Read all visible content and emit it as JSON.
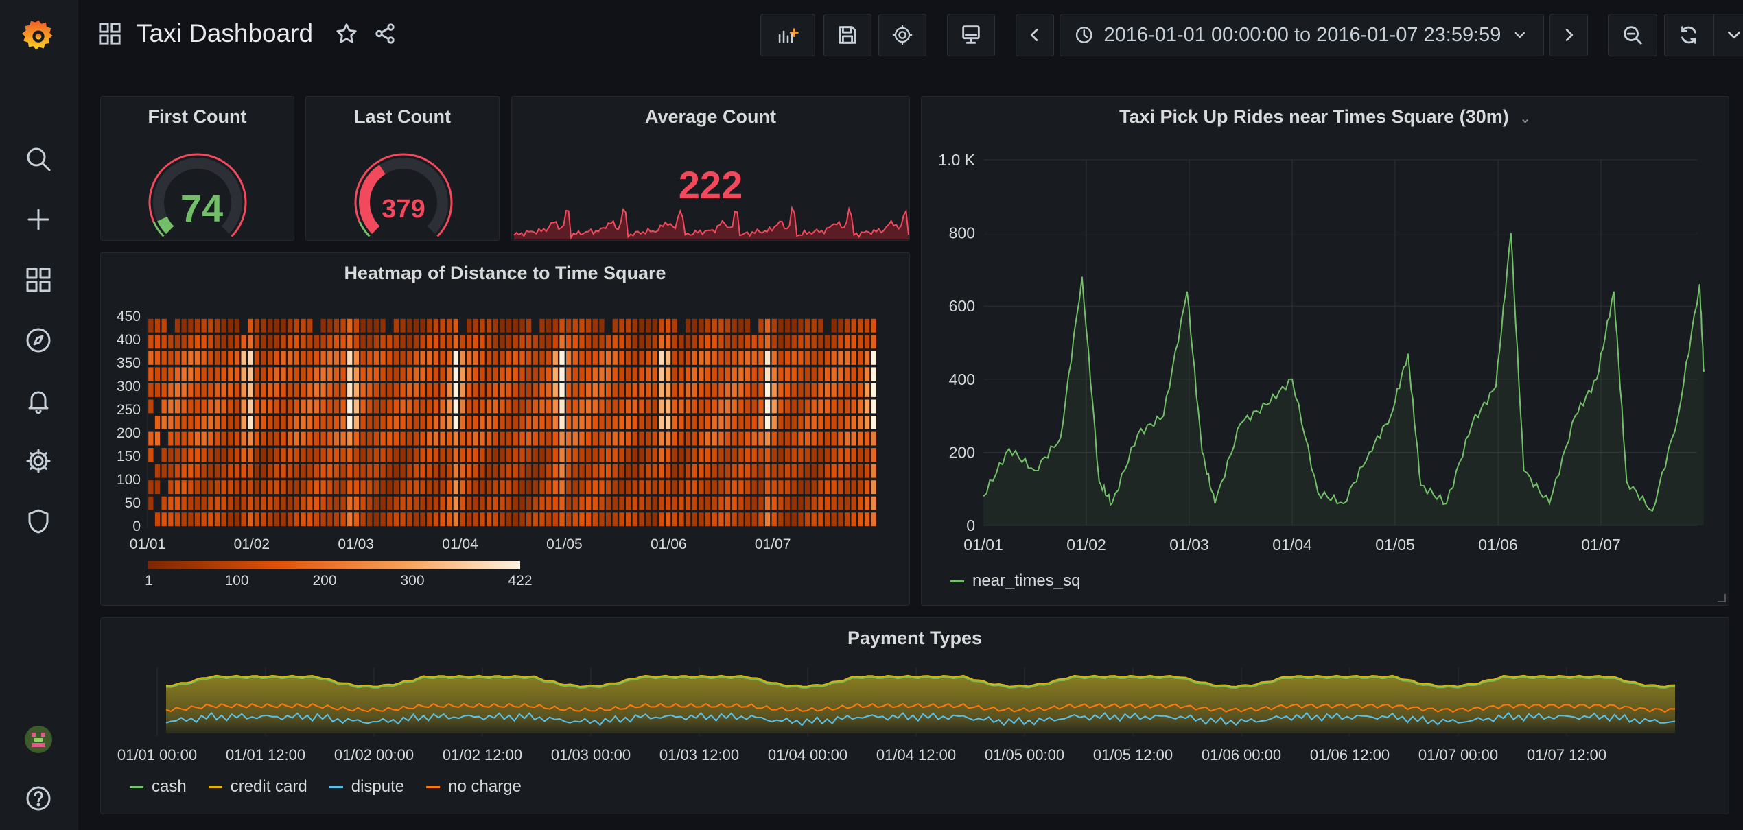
{
  "dashboard": {
    "title": "Taxi Dashboard"
  },
  "toolbar": {
    "time_range": "2016-01-01 00:00:00 to 2016-01-07 23:59:59"
  },
  "colors": {
    "accent_red": "#f2495c",
    "accent_green": "#73bf69",
    "line_green": "#73bf69",
    "cash": "#73bf69",
    "credit_card": "#e0b400",
    "dispute": "#5ac0e8",
    "no_charge": "#ff780a"
  },
  "icons": {
    "sidebar": [
      "grafana-logo-icon",
      "search-icon",
      "plus-icon",
      "dashboards-icon",
      "explore-icon",
      "alerting-icon",
      "gear-icon",
      "shield-icon",
      "user-avatar",
      "help-icon"
    ],
    "toolbar": [
      "add-panel-icon",
      "save-icon",
      "gear-icon",
      "tv-mode-icon",
      "chevron-left-icon",
      "clock-icon",
      "chevron-down-icon",
      "chevron-right-icon",
      "zoom-out-icon",
      "refresh-icon",
      "chevron-down-icon"
    ]
  },
  "panels": {
    "first_count": {
      "title": "First Count",
      "value": "74",
      "gauge": {
        "value": 74,
        "min": 0,
        "max": 1000
      }
    },
    "last_count": {
      "title": "Last Count",
      "value": "379",
      "gauge": {
        "value": 379,
        "min": 0,
        "max": 1000
      }
    },
    "average_count": {
      "title": "Average Count",
      "value": "222"
    },
    "heatmap": {
      "title": "Heatmap of Distance to Time Square",
      "y_ticks": [
        "450",
        "400",
        "350",
        "300",
        "250",
        "200",
        "150",
        "100",
        "50",
        "0"
      ],
      "x_ticks": [
        "01/01",
        "01/02",
        "01/03",
        "01/04",
        "01/05",
        "01/06",
        "01/07"
      ],
      "scale_labels": [
        "1",
        "100",
        "200",
        "300",
        "422"
      ]
    },
    "rides": {
      "title": "Taxi Pick Up Rides near Times Square (30m)",
      "y_ticks": [
        "1.0 K",
        "800",
        "600",
        "400",
        "200",
        "0"
      ],
      "x_ticks": [
        "01/01",
        "01/02",
        "01/03",
        "01/04",
        "01/05",
        "01/06",
        "01/07"
      ],
      "legend": "near_times_sq"
    },
    "payment": {
      "title": "Payment Types",
      "x_ticks": [
        "01/01 00:00",
        "01/01 12:00",
        "01/02 00:00",
        "01/02 12:00",
        "01/03 00:00",
        "01/03 12:00",
        "01/04 00:00",
        "01/04 12:00",
        "01/05 00:00",
        "01/05 12:00",
        "01/06 00:00",
        "01/06 12:00",
        "01/07 00:00",
        "01/07 12:00"
      ],
      "legend": [
        "cash",
        "credit card",
        "dispute",
        "no charge"
      ]
    }
  },
  "chart_data": [
    {
      "type": "line",
      "title": "Taxi Pick Up Rides near Times Square (30m)",
      "x": [
        "01/01 00:00",
        "01/01 06:00",
        "01/01 12:00",
        "01/01 18:00",
        "01/01 23:00",
        "01/02 03:00",
        "01/02 06:00",
        "01/02 12:00",
        "01/02 18:00",
        "01/02 23:30",
        "01/03 03:00",
        "01/03 06:00",
        "01/03 12:00",
        "01/03 18:00",
        "01/04 00:00",
        "01/04 06:00",
        "01/04 12:00",
        "01/04 18:00",
        "01/04 23:00",
        "01/05 03:00",
        "01/05 06:00",
        "01/05 12:00",
        "01/05 18:00",
        "01/05 23:30",
        "01/06 03:00",
        "01/06 06:00",
        "01/06 12:00",
        "01/06 18:00",
        "01/06 23:00",
        "01/07 03:00",
        "01/07 06:00",
        "01/07 12:00",
        "01/07 18:00",
        "01/07 23:00",
        "01/07 23:59"
      ],
      "series": [
        {
          "name": "near_times_sq",
          "values": [
            80,
            210,
            150,
            240,
            680,
            120,
            60,
            250,
            300,
            640,
            200,
            60,
            280,
            330,
            400,
            90,
            60,
            200,
            300,
            470,
            110,
            60,
            280,
            380,
            800,
            150,
            60,
            300,
            400,
            640,
            120,
            40,
            300,
            660,
            420
          ]
        }
      ],
      "ylim": [
        0,
        1000
      ],
      "legend": "bottom-left"
    },
    {
      "type": "heatmap",
      "title": "Heatmap of Distance to Time Square",
      "x_range": [
        "01/01",
        "01/07"
      ],
      "y_range": [
        0,
        450
      ],
      "color_scale": [
        1,
        422
      ],
      "hot_columns_day_fraction": [
        0.93,
        1.93,
        2.93,
        3.93,
        4.93,
        5.93,
        6.93
      ],
      "legend": "bottom"
    },
    {
      "type": "area",
      "title": "Payment Types",
      "series": [
        {
          "name": "cash",
          "values": []
        },
        {
          "name": "credit card",
          "values": []
        },
        {
          "name": "dispute",
          "values": []
        },
        {
          "name": "no charge",
          "values": []
        }
      ],
      "legend": "bottom-left"
    }
  ]
}
